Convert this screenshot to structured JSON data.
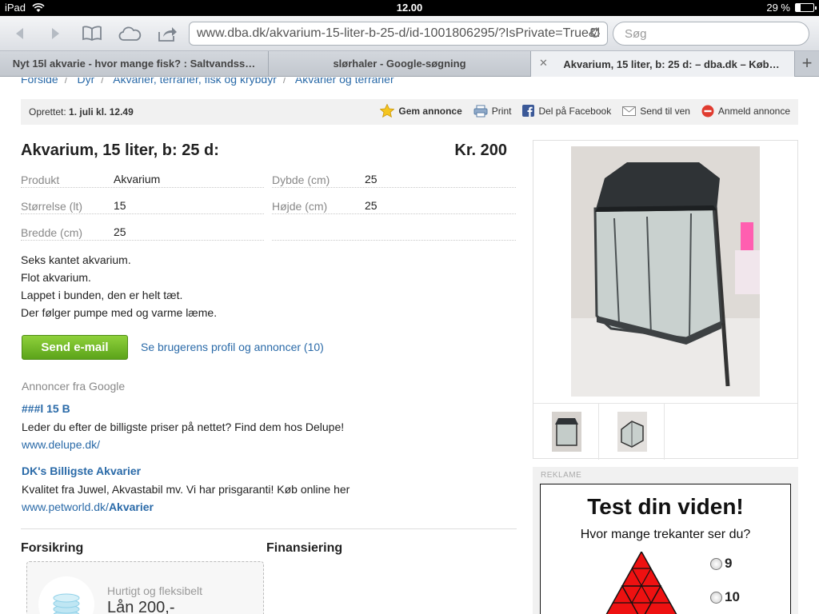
{
  "status": {
    "device": "iPad",
    "time": "12.00",
    "battery": "29 %",
    "battery_level": 0.29
  },
  "browser": {
    "url": "www.dba.dk/akvarium-15-liter-b-25-d/id-1001806295/?IsPrivate=True&l",
    "search_placeholder": "Søg",
    "tabs": [
      {
        "label": "Nyt 15l akvarie - hvor mange fisk? : Saltvandss…",
        "active": false
      },
      {
        "label": "slørhaler - Google-søgning",
        "active": false
      },
      {
        "label": "Akvarium, 15 liter, b: 25 d: – dba.dk – Køb…",
        "active": true
      }
    ]
  },
  "breadcrumb": [
    "Forside",
    "Dyr",
    "Akvarier, terrarier, fisk og krybdyr",
    "Akvarier og terrarier"
  ],
  "listing": {
    "created_label": "Oprettet:",
    "created_value": "1. juli kl. 12.49",
    "actions": {
      "save": "Gem annonce",
      "print": "Print",
      "facebook": "Del på Facebook",
      "send_friend": "Send til ven",
      "report": "Anmeld annonce"
    },
    "title": "Akvarium, 15 liter, b: 25 d:",
    "price": "Kr. 200",
    "specs": [
      {
        "label": "Produkt",
        "value": "Akvarium"
      },
      {
        "label": "Dybde (cm)",
        "value": "25"
      },
      {
        "label": "Størrelse (lt)",
        "value": "15"
      },
      {
        "label": "Højde (cm)",
        "value": "25"
      },
      {
        "label": "Bredde (cm)",
        "value": "25"
      }
    ],
    "description": [
      "Seks kantet akvarium.",
      "Flot akvarium.",
      "Lappet i bunden, den er helt tæt.",
      "Der følger pumpe med og varme læme."
    ],
    "send_email": "Send e-mail",
    "profile_link": "Se brugerens profil og annoncer (10)"
  },
  "google_ads": {
    "header": "Annoncer fra Google",
    "ads": [
      {
        "title": "###l 15 B",
        "text": "Leder du efter de billigste priser på nettet? Find dem hos Delupe!",
        "url": "www.delupe.dk/",
        "url_bold": ""
      },
      {
        "title": "DK's Billigste Akvarier",
        "text": "Kvalitet fra Juwel, Akvastabil mv. Vi har prisgaranti! Køb online her",
        "url": "www.petworld.dk/",
        "url_bold": "Akvarier"
      }
    ]
  },
  "sections": {
    "insurance": "Forsikring",
    "financing": "Finansiering",
    "loan_small": "Hurtigt og fleksibelt",
    "loan_big": "Lån 200,-"
  },
  "sidebar_ad": {
    "label": "REKLAME",
    "title": "Test din viden!",
    "question": "Hvor mange trekanter ser du?",
    "options": [
      "9",
      "10"
    ]
  },
  "colors": {
    "link": "#2a6aa8",
    "button_green": "#6fb823",
    "quiz_red": "#ee1111"
  }
}
